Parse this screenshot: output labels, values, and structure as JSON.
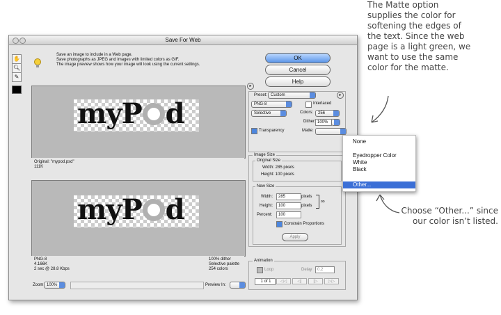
{
  "window": {
    "title": "Save For Web"
  },
  "info": {
    "line1": "Save an image to include in a Web page.",
    "line2": "Save photographs as JPEG and images with limited colors as GIF.",
    "line3": "The image preview shows how your image will look using the current settings."
  },
  "buttons": {
    "ok": "OK",
    "cancel": "Cancel",
    "help": "Help",
    "apply": "Apply"
  },
  "preview_top": {
    "logo_left": "myP",
    "logo_right": "d",
    "original_label": "Original: \"mypod.psd\"",
    "size": "111K"
  },
  "preview_bottom": {
    "logo_left": "myP",
    "logo_right": "d",
    "format": "PNG-8",
    "size": "4.166K",
    "time": "2 sec @ 28.8 Kbps",
    "dither": "100% dither",
    "palette": "Selective palette",
    "colors": "254 colors"
  },
  "settings": {
    "preset_label": "Preset:",
    "preset_value": "Custom",
    "format_value": "PNG-8",
    "interlaced_label": "Interlaced",
    "reduction_value": "Selective",
    "colors_label": "Colors:",
    "colors_value": "256",
    "dither_label": "Dither:",
    "dither_value": "100%",
    "transparency_label": "Transparency",
    "matte_label": "Matte:"
  },
  "image_size": {
    "title": "Image Size",
    "original_title": "Original Size",
    "orig_width": "Width:  285 pixels",
    "orig_height": "Height:  100 pixels",
    "new_title": "New Size",
    "width_label": "Width:",
    "width_value": "285",
    "height_label": "Height:",
    "height_value": "100",
    "pixels": "pixels",
    "percent_label": "Percent:",
    "percent_value": "100",
    "constrain_label": "Constrain Proportions"
  },
  "animation": {
    "title": "Animation",
    "loop": "Loop",
    "delay_label": "Delay",
    "delay_value": "0.2",
    "frame": "1 of 1"
  },
  "bottom": {
    "zoom_label": "Zoom:",
    "zoom_value": "100%",
    "preview_in_label": "Preview In:"
  },
  "matte_menu": {
    "items": [
      "None",
      "Eyedropper Color",
      "White",
      "Black",
      "Other..."
    ],
    "selected": "Other..."
  },
  "annotations": {
    "top": [
      "The Matte option",
      "supplies the color for",
      "softening the edges of",
      "the text. Since the web",
      "page is a light green, we",
      "want to use the same",
      "color for the matte."
    ],
    "bottom": [
      "Choose “Other...” since",
      "our color isn’t listed."
    ]
  }
}
